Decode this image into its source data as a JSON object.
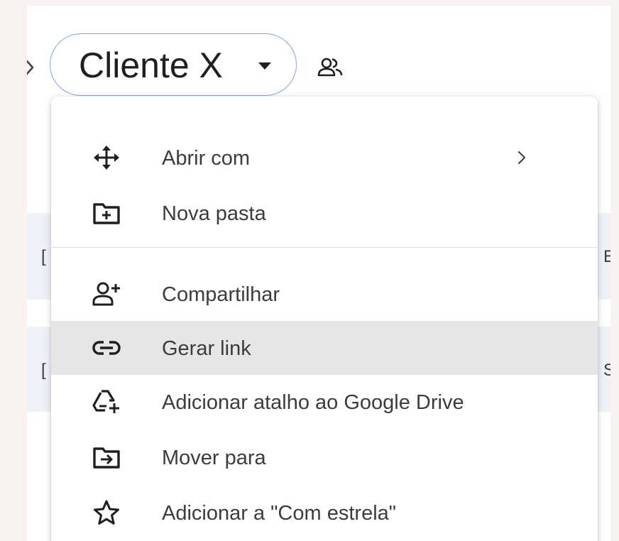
{
  "breadcrumb": {
    "current_folder": "Cliente X",
    "chevron_icon": "chevron-right-icon",
    "caret_icon": "caret-down-icon",
    "shared_icon": "people-icon"
  },
  "background_rows": [
    {
      "left_char": "[",
      "right_char": "E"
    },
    {
      "left_char": "[",
      "right_char": "S"
    }
  ],
  "context_menu": {
    "items": [
      {
        "label": "Abrir com",
        "icon": "open-with-icon",
        "has_submenu": true
      },
      {
        "label": "Nova pasta",
        "icon": "new-folder-icon"
      },
      {
        "label": "Compartilhar",
        "icon": "person-add-icon"
      },
      {
        "label": "Gerar link",
        "icon": "link-icon",
        "highlighted": true
      },
      {
        "label": "Adicionar atalho ao Google Drive",
        "icon": "add-shortcut-icon"
      },
      {
        "label": "Mover para",
        "icon": "move-folder-icon"
      },
      {
        "label": "Adicionar a \"Com estrela\"",
        "icon": "star-icon"
      }
    ]
  },
  "colors": {
    "page_background": "#f8f3f1",
    "chip_border": "#7ea6e0",
    "highlight": "#e6e6e6",
    "row_background": "#eef1f8",
    "icon": "#1f1f1f",
    "text": "#3c3c3c"
  }
}
